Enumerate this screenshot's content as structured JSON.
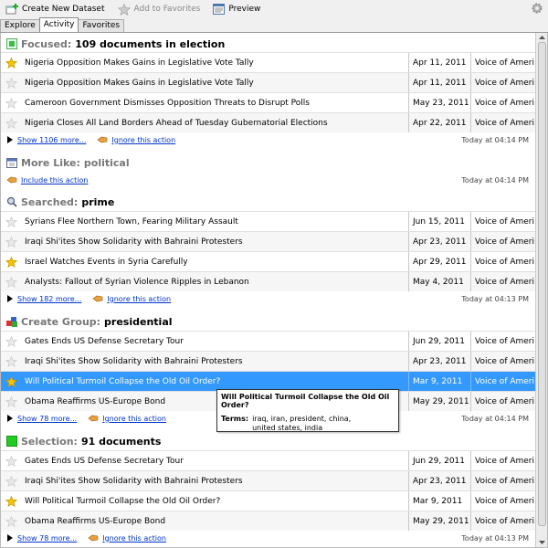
{
  "toolbar": {
    "create_label": "Create New Dataset",
    "favorites_label": "Add to Favorites",
    "preview_label": "Preview"
  },
  "tabs": [
    {
      "label": "Explore"
    },
    {
      "label": "Activity"
    },
    {
      "label": "Favorites"
    }
  ],
  "sections": {
    "focused": {
      "label": "Focused:",
      "value": "109 documents in election",
      "rows": [
        {
          "title": "Nigeria Opposition Makes Gains in Legislative Vote Tally",
          "date": "Apr 11, 2011",
          "source": "Voice of Ameri...",
          "starred": true
        },
        {
          "title": "Nigeria Opposition Makes Gains in Legislative Vote Tally",
          "date": "Apr 11, 2011",
          "source": "Voice of Ameri...",
          "starred": false
        },
        {
          "title": "Cameroon Government Dismisses Opposition Threats to Disrupt Polls",
          "date": "May 23, 2011",
          "source": "Voice of Ameri...",
          "starred": false
        },
        {
          "title": "Nigeria Closes All Land Borders Ahead of Tuesday  Gubernatorial Elections",
          "date": "Apr 22, 2011",
          "source": "Voice of Ameri...",
          "starred": false
        }
      ],
      "show_more": "Show 1106 more...",
      "ignore": "Ignore this action",
      "timestamp": "Today at 04:14 PM"
    },
    "more_like": {
      "label": "More Like:",
      "value": "political",
      "include": "Include this action",
      "timestamp": "Today at 04:14 PM"
    },
    "searched": {
      "label": "Searched:",
      "value": "prime",
      "rows": [
        {
          "title": "Syrians Flee Northern Town, Fearing Military Assault",
          "date": "Jun 15, 2011",
          "source": "Voice of Ameri...",
          "starred": false
        },
        {
          "title": "Iraqi Shi'ites Show Solidarity with Bahraini Protesters",
          "date": "Apr 23, 2011",
          "source": "Voice of Ameri...",
          "starred": false
        },
        {
          "title": "Israel Watches Events in Syria Carefully",
          "date": "Apr 29, 2011",
          "source": "Voice of Ameri...",
          "starred": true
        },
        {
          "title": "Analysts: Fallout of Syrian Violence Ripples in Lebanon",
          "date": "May 4, 2011",
          "source": "Voice of Ameri...",
          "starred": false
        }
      ],
      "show_more": "Show 182 more...",
      "ignore": "Ignore this action",
      "timestamp": "Today at 04:13 PM"
    },
    "create_group": {
      "label": "Create Group:",
      "value": "presidential",
      "rows": [
        {
          "title": "Gates Ends US Defense Secretary Tour",
          "date": "Jun 29, 2011",
          "source": "Voice of Ameri...",
          "starred": false
        },
        {
          "title": "Iraqi Shi'ites Show Solidarity with Bahraini Protesters",
          "date": "Apr 23, 2011",
          "source": "Voice of Ameri...",
          "starred": false
        },
        {
          "title": "Will Political Turmoil Collapse the Old Oil Order?",
          "date": "Mar 9, 2011",
          "source": "Voice of Ameri...",
          "starred": true
        },
        {
          "title": "Obama Reaffirms US-Europe Bond",
          "date": "May 29, 2011",
          "source": "Voice of Ameri...",
          "starred": false
        }
      ],
      "show_more": "Show 78 more...",
      "ignore": "Ignore this action",
      "timestamp": "Today at 04:14 PM"
    },
    "selection": {
      "label": "Selection:",
      "value": "91 documents",
      "rows": [
        {
          "title": "Gates Ends US Defense Secretary Tour",
          "date": "Jun 29, 2011",
          "source": "Voice of Ameri...",
          "starred": false
        },
        {
          "title": "Iraqi Shi'ites Show Solidarity with Bahraini Protesters",
          "date": "Apr 23, 2011",
          "source": "Voice of Ameri...",
          "starred": false
        },
        {
          "title": "Will Political Turmoil Collapse the Old Oil Order?",
          "date": "Mar 9, 2011",
          "source": "Voice of Ameri...",
          "starred": true
        },
        {
          "title": "Obama Reaffirms US-Europe Bond",
          "date": "May 29, 2011",
          "source": "Voice of Ameri...",
          "starred": false
        }
      ],
      "show_more": "Show 78 more...",
      "ignore": "Ignore this action",
      "timestamp": "Today at 04:13 PM"
    }
  },
  "tooltip": {
    "title": "Will Political Turmoil Collapse the Old Oil Order?",
    "terms_label": "Terms:",
    "terms_value": "iraq, iran, president, china, united states, india"
  },
  "colors": {
    "selected": "#3399ff",
    "star": "#f5c400",
    "link": "#0033cc",
    "selection_square": "#22cc22"
  }
}
